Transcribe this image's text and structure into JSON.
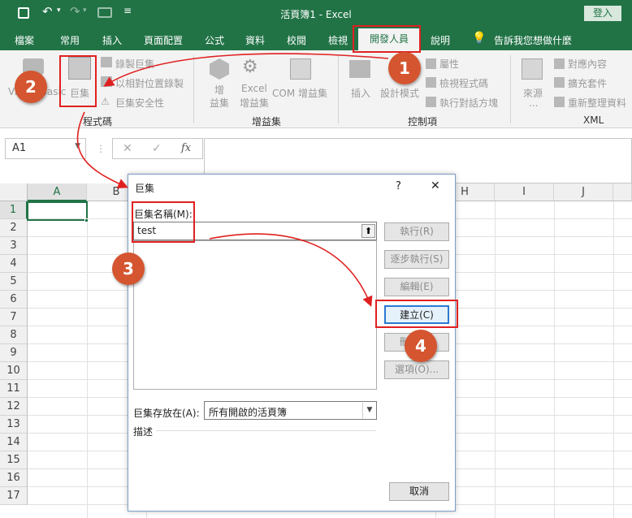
{
  "titlebar": {
    "title": "活頁簿1  -  Excel",
    "login": "登入"
  },
  "tabs": [
    "檔案",
    "常用",
    "插入",
    "頁面配置",
    "公式",
    "資料",
    "校閱",
    "檢視",
    "開發人員",
    "說明",
    "告訴我您想做什麼"
  ],
  "ribbon": {
    "code": {
      "visual_basic": "Visual Basic",
      "macros": "巨集",
      "record": "錄製巨集",
      "relative": "以相對位置錄製",
      "security": "巨集安全性",
      "group": "程式碼"
    },
    "addins": {
      "addins": [
        "增",
        "益集"
      ],
      "excel_addins": [
        "Excel",
        "增益集"
      ],
      "com_addins": "COM 增益集",
      "group": "增益集"
    },
    "controls": {
      "insert": "插入",
      "design_mode": "設計模式",
      "properties": "屬性",
      "view_code": "檢視程式碼",
      "run_dialog": "執行對話方塊",
      "group": "控制項"
    },
    "xml": {
      "source": [
        "來源",
        "..."
      ],
      "map_props": "對應內容",
      "expansion": "擴充套件",
      "refresh": "重新整理資料",
      "group": "XML"
    }
  },
  "formula_bar": {
    "name_box": "A1",
    "cancel": "✕",
    "enter": "✓",
    "fx": "fx"
  },
  "sheet": {
    "columns": [
      "A",
      "B",
      "H",
      "I",
      "J"
    ],
    "rows": [
      "1",
      "2",
      "3",
      "4",
      "5",
      "6",
      "7",
      "8",
      "9",
      "10",
      "11",
      "12",
      "13",
      "14",
      "15",
      "16",
      "17"
    ]
  },
  "dialog": {
    "title": "巨集",
    "help": "?",
    "close": "✕",
    "name_label": "巨集名稱(M):",
    "name_value": "test",
    "buttons": {
      "run": "執行(R)",
      "step": "逐步執行(S)",
      "edit": "編輯(E)",
      "create": "建立(C)",
      "delete": "刪除(D)",
      "options": "選項(O)...",
      "cancel": "取消"
    },
    "store_label": "巨集存放在(A):",
    "store_value": "所有開啟的活頁簿",
    "desc_label": "描述"
  },
  "annotations": {
    "steps": [
      "1",
      "2",
      "3",
      "4"
    ],
    "accent": "#e02020",
    "badge_color": "#d4552f"
  },
  "colors": {
    "excel_green": "#217346",
    "dialog_border": "#7d9fc6",
    "focus_blue": "#2b7ad0"
  }
}
